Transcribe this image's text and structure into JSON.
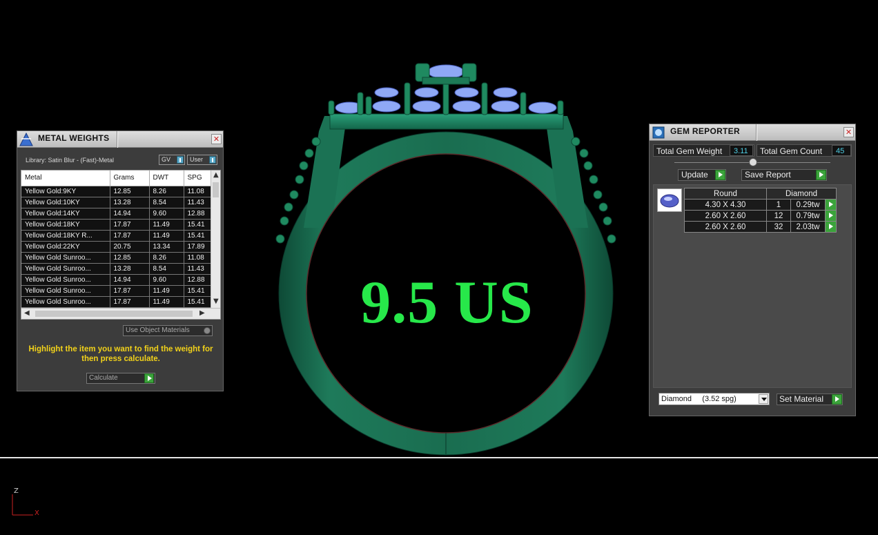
{
  "viewport": {
    "ring_size_label": "9.5 US",
    "axis_z": "Z",
    "axis_x": "X"
  },
  "metal_weights": {
    "title": "METAL WEIGHTS",
    "library": "Library: Satin Blur - (Fast)-Metal",
    "gv_label": "GV",
    "user_label": "User",
    "columns": [
      "Metal",
      "Grams",
      "DWT",
      "SPG"
    ],
    "rows": [
      [
        "Yellow Gold:9KY",
        "12.85",
        "8.26",
        "11.08"
      ],
      [
        "Yellow Gold:10KY",
        "13.28",
        "8.54",
        "11.43"
      ],
      [
        "Yellow Gold:14KY",
        "14.94",
        "9.60",
        "12.88"
      ],
      [
        "Yellow Gold:18KY",
        "17.87",
        "11.49",
        "15.41"
      ],
      [
        "Yellow Gold:18KY R...",
        "17.87",
        "11.49",
        "15.41"
      ],
      [
        "Yellow Gold:22KY",
        "20.75",
        "13.34",
        "17.89"
      ],
      [
        "Yellow Gold Sunroo...",
        "12.85",
        "8.26",
        "11.08"
      ],
      [
        "Yellow Gold Sunroo...",
        "13.28",
        "8.54",
        "11.43"
      ],
      [
        "Yellow Gold Sunroo...",
        "14.94",
        "9.60",
        "12.88"
      ],
      [
        "Yellow Gold Sunroo...",
        "17.87",
        "11.49",
        "15.41"
      ],
      [
        "Yellow Gold Sunroo...",
        "17.87",
        "11.49",
        "15.41"
      ]
    ],
    "use_object_materials": "Use Object Materials",
    "hint": "Highlight the item you want to find the weight for then press calculate.",
    "calculate_label": "Calculate"
  },
  "gem_reporter": {
    "title": "GEM REPORTER",
    "total_weight_label": "Total Gem Weight",
    "total_weight_value": "3.11",
    "total_count_label": "Total Gem Count",
    "total_count_value": "45",
    "update_label": "Update",
    "save_report_label": "Save Report",
    "table_headers": [
      "Round",
      "Diamond"
    ],
    "gems": [
      [
        "4.30 X 4.30",
        "1",
        "0.29tw"
      ],
      [
        "2.60 X 2.60",
        "12",
        "0.79tw"
      ],
      [
        "2.60 X 2.60",
        "32",
        "2.03tw"
      ]
    ],
    "material_value": "Diamond     (3.52 spg)",
    "set_material_label": "Set Material"
  },
  "colors": {
    "ring_green": "#1f7a5a",
    "gem_blue": "#8fa8f5",
    "size_text": "#27e84a",
    "hint_yellow": "#f2d21a"
  }
}
